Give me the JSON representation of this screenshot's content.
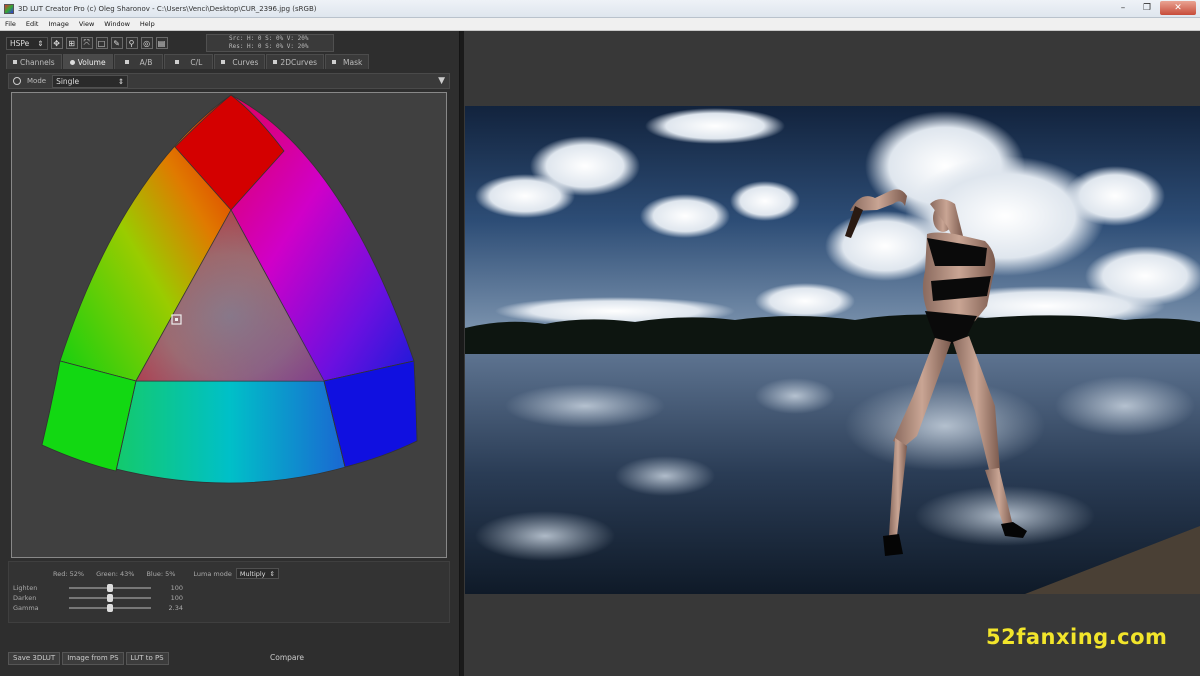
{
  "window": {
    "title": "3D LUT Creator Pro (c) Oleg Sharonov - C:\\Users\\Venci\\Desktop\\CUR_2396.jpg (sRGB)",
    "minimize": "–",
    "maximize": "❐",
    "close": "✕"
  },
  "menu": [
    "File",
    "Edit",
    "Image",
    "View",
    "Window",
    "Help"
  ],
  "toolbar": {
    "colorspace": "HSPe",
    "readout": {
      "src": "Src: H:   0    S:   0%   V:  20%",
      "res": "Res: H:   0    S:   0%   V:  20%"
    }
  },
  "tabs": [
    {
      "label": "Channels",
      "active": false
    },
    {
      "label": "Volume",
      "active": true
    },
    {
      "label": "A/B",
      "active": false
    },
    {
      "label": "C/L",
      "active": false
    },
    {
      "label": "Curves",
      "active": false
    },
    {
      "label": "2DCurves",
      "active": false
    },
    {
      "label": "Mask",
      "active": false
    }
  ],
  "mode": {
    "label": "Mode",
    "value": "Single"
  },
  "color_values": {
    "red": "Red:  52%",
    "green": "Green:  43%",
    "blue": "Blue:  5%",
    "luma_label": "Luma mode",
    "luma_value": "Multiply"
  },
  "sliders": [
    {
      "label": "Lighten",
      "value": "100",
      "level": 0.5
    },
    {
      "label": "Darken",
      "value": "100",
      "level": 0.5
    },
    {
      "label": "Gamma",
      "value": "2.34",
      "level": 0.5
    }
  ],
  "footer": {
    "buttons": [
      "Save 3DLUT",
      "Image from PS",
      "LUT to PS"
    ],
    "compare": "Compare"
  },
  "watermark": "52fanxing.com",
  "colors": {
    "panel": "#2e2e2e",
    "viewer": "#383838",
    "watermark": "#f2e52b"
  }
}
